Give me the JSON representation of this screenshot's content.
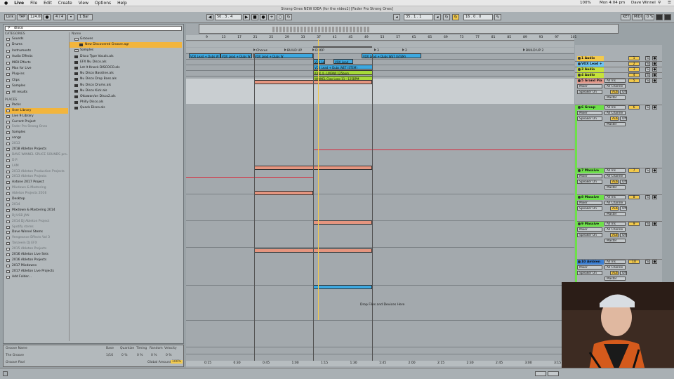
{
  "menubar": {
    "apple": "",
    "app": "Live",
    "items": [
      "File",
      "Edit",
      "Create",
      "View",
      "Options",
      "Help"
    ],
    "battery": "100%",
    "time": "Mon 4:04 pm",
    "user": "Dave Winnel"
  },
  "window_title": "Strong Ones NEW IDEA (for the video2) [Fader Pro Strong Ones]",
  "transport": {
    "link": "Link",
    "tap": "TAP",
    "tempo": "124.00",
    "time_sig": "4 / 4",
    "quantize": "1 Bar",
    "position": "50 . 3 . 4",
    "loop_start": "35 . 1 . 1",
    "loop_len": "16 . 0 . 0",
    "key": "KEY",
    "midi": "MIDI",
    "cpu": "0 %"
  },
  "browser": {
    "search_value": "disco",
    "categories_header": "CATEGORIES",
    "categories": [
      "Sounds",
      "Drums",
      "Instruments",
      "Audio Effects",
      "MIDI Effects",
      "Max for Live",
      "Plug-ins",
      "Clips",
      "Samples",
      "All results"
    ],
    "places_header": "PLACES",
    "places": [
      {
        "label": "Packs",
        "dim": false
      },
      {
        "label": "User Library",
        "dim": false,
        "selected": true
      },
      {
        "label": "Live 9 Library",
        "dim": false
      },
      {
        "label": "Current Project",
        "dim": false
      },
      {
        "label": "Fader Pro Strong Ones",
        "dim": true
      },
      {
        "label": "Samples",
        "dim": false
      },
      {
        "label": "songs",
        "dim": false
      },
      {
        "label": "2013",
        "dim": true
      },
      {
        "label": "2018 Ableton Projects",
        "dim": false
      },
      {
        "label": "DAVE WINNEL SPLICE SOUNDS pro...",
        "dim": true
      },
      {
        "label": "D.P.",
        "dim": true
      },
      {
        "label": "LAM",
        "dim": true
      },
      {
        "label": "2013 Ableton Production Projects",
        "dim": true
      },
      {
        "label": "2013 Ableton Projects",
        "dim": true
      },
      {
        "label": "Axtone 2017 Project",
        "dim": false
      },
      {
        "label": "Mixdown & Mastering",
        "dim": true
      },
      {
        "label": "Ableton Projects 2016",
        "dim": true
      },
      {
        "label": "Desktop",
        "dim": false
      },
      {
        "label": "2014",
        "dim": true
      },
      {
        "label": "Mixdown & Mastering 2014",
        "dim": false
      },
      {
        "label": "DJ USB JAN",
        "dim": true
      },
      {
        "label": "2014 DJ Ableton Project",
        "dim": true
      },
      {
        "label": "Spotify stems",
        "dim": true
      },
      {
        "label": "Dave Winnel Stems",
        "dim": false
      },
      {
        "label": "Vengeance Effects Vol 3",
        "dim": true
      },
      {
        "label": "Tanzeein DJ EFX",
        "dim": true
      },
      {
        "label": "2015 Ableton Projects",
        "dim": true
      },
      {
        "label": "2016 Ableton Live Sets",
        "dim": false
      },
      {
        "label": "2016 Ableton Projects",
        "dim": false
      },
      {
        "label": "2017 Mixdowns",
        "dim": false
      },
      {
        "label": "2017 Ableton Live Projects",
        "dim": false
      },
      {
        "label": "Add Folder...",
        "dim": false
      }
    ],
    "files_header": "Name",
    "files": [
      {
        "label": "Grooves",
        "kind": "folder",
        "indent": 0
      },
      {
        "label": "New Discovered Groove.agr",
        "kind": "file",
        "indent": 1,
        "selected": true
      },
      {
        "label": "Samples",
        "kind": "folder",
        "indent": 0
      },
      {
        "label": "Disco Type Vocals.als",
        "kind": "file",
        "indent": 0
      },
      {
        "label": "EFX Nu Disco.als",
        "kind": "file",
        "indent": 0
      },
      {
        "label": "Let It Knock DISCOCO.als",
        "kind": "file",
        "indent": 0
      },
      {
        "label": "Nu Disco Bassline.als",
        "kind": "file",
        "indent": 0
      },
      {
        "label": "Nu Disco Drop Bass.als",
        "kind": "file",
        "indent": 0
      },
      {
        "label": "Nu Disco Drums.als",
        "kind": "file",
        "indent": 0
      },
      {
        "label": "Nu Disco Kick.als",
        "kind": "file",
        "indent": 0
      },
      {
        "label": "Ottawan/on Disco2.als",
        "kind": "file",
        "indent": 0
      },
      {
        "label": "Philly Disco.als",
        "kind": "file",
        "indent": 0
      },
      {
        "label": "Quack Disco.als",
        "kind": "file",
        "indent": 0
      }
    ]
  },
  "groove_pool": {
    "headers": [
      "Groove Name",
      "Base",
      "Quantize",
      "Timing",
      "Random",
      "Velocity"
    ],
    "row_name": "The Groove",
    "row_values": [
      "1/16",
      "0 %",
      "0 %",
      "0 %",
      "0 %"
    ],
    "pool_label": "Groove Pool",
    "global_label": "Global Amount",
    "global_value": "100%"
  },
  "arrangement": {
    "ruler": [
      "9",
      "13",
      "17",
      "21",
      "25",
      "29",
      "33",
      "37",
      "41",
      "45",
      "49",
      "53",
      "57",
      "61",
      "65",
      "69",
      "73",
      "77",
      "81",
      "85",
      "89",
      "93",
      "97",
      "101"
    ],
    "locators": [
      {
        "label": "Chorus"
      },
      {
        "label": "BUILD UP"
      },
      {
        "label": "DROP"
      },
      {
        "label": "3"
      },
      {
        "label": "2"
      },
      {
        "label": "BUILD UP 2"
      }
    ],
    "set_btn": "Set",
    "clips": [
      {
        "label": "VOX Lead + Dubs W"
      },
      {
        "label": "VOX Lead + Dubs W"
      },
      {
        "label": "VOX Lead + Dubs W"
      },
      {
        "label": "VOX Lead"
      },
      {
        "label": "VOX Lead"
      },
      {
        "label": "VOX Lead + Dubs WET (STEM)"
      },
      {
        "label": "VOX Lead + Dubs WET (STEM)"
      },
      {
        "label": "KICK 4 - LMFAW 125bpm"
      },
      {
        "label": "WINNEL Clap Loop 11 - 125BPM"
      }
    ],
    "drop_hint": "Drop Files and Devices Here",
    "time_axis": [
      "0:15",
      "0:30",
      "0:45",
      "1:00",
      "1:15",
      "1:30",
      "1:45",
      "2:00",
      "2:15",
      "2:30",
      "2:45",
      "3:00",
      "3:15"
    ]
  },
  "mixer": {
    "tracks": [
      {
        "name": "1 Audio",
        "color": "#f2c94c",
        "num": "1"
      },
      {
        "name": "VOX Lead +",
        "color": "#6ec3f0",
        "num": "2"
      },
      {
        "name": "3 Audio",
        "color": "#c6e23a",
        "num": "3"
      },
      {
        "name": "4 Audio",
        "color": "#c6e23a",
        "num": "4"
      },
      {
        "name": "5 Grand Pia",
        "color": "#e39a8c",
        "num": "5"
      },
      {
        "name": "6 Group",
        "color": "#6ee04a",
        "num": "6"
      },
      {
        "name": "7 Massive",
        "color": "#6ee04a",
        "num": "7"
      },
      {
        "name": "8 Massive",
        "color": "#6ee04a",
        "num": "8"
      },
      {
        "name": "9 Massive",
        "color": "#6ee04a",
        "num": "9"
      },
      {
        "name": "10 Ambien",
        "color": "#3b7fd4",
        "num": "10"
      }
    ],
    "labels": {
      "all_ins": "All Ins",
      "all_channels": "All Channe",
      "master": "Master",
      "speaker_on": "Speaker On",
      "group": "Group",
      "auto": "Auto",
      "off": "Off",
      "in": "In",
      "mixer": "Mixer",
      "mixer_rig": "Mixer",
      "wave": "Wave"
    }
  },
  "colors": {
    "accent": "#f2b53d",
    "vox_clip": "#3da8e0",
    "green_clip": "#a6d93a",
    "salmon_clip": "#e5957f",
    "red_line": "#d8283a"
  }
}
